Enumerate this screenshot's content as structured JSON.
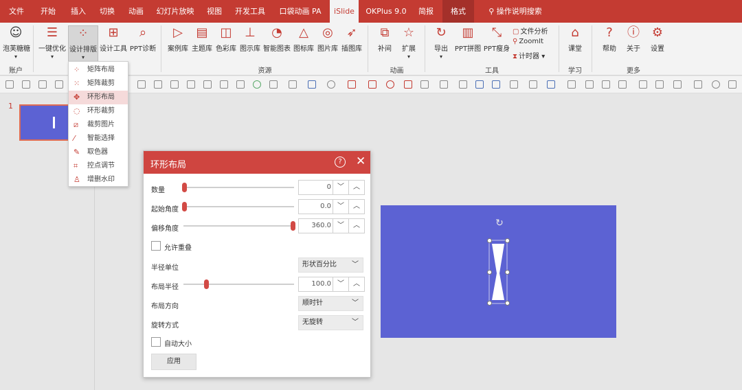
{
  "tabs": [
    {
      "label": "文件"
    },
    {
      "label": "开始"
    },
    {
      "label": "插入"
    },
    {
      "label": "切换"
    },
    {
      "label": "动画"
    },
    {
      "label": "幻灯片放映"
    },
    {
      "label": "视图"
    },
    {
      "label": "开发工具"
    },
    {
      "label": "口袋动画 PA"
    },
    {
      "label": "iSlide"
    },
    {
      "label": "OKPlus 9.0"
    },
    {
      "label": "简报"
    },
    {
      "label": "格式"
    }
  ],
  "tell_me": "操作说明搜索",
  "ribbon": {
    "account": {
      "button": "泡芙糖糖",
      "group": "账户"
    },
    "design": {
      "one_click": "一键优化",
      "layout": "设计排版",
      "tools": "设计工具",
      "diagnose": "PPT诊断"
    },
    "resources": {
      "group": "资源",
      "items": [
        {
          "label": "案例库"
        },
        {
          "label": "主题库"
        },
        {
          "label": "色彩库"
        },
        {
          "label": "图示库"
        },
        {
          "label": "智能图表"
        },
        {
          "label": "图标库"
        },
        {
          "label": "图片库"
        },
        {
          "label": "插图库"
        }
      ]
    },
    "animation": {
      "group": "动画",
      "tween": "补间",
      "extend": "扩展"
    },
    "tools": {
      "group": "工具",
      "export": "导出",
      "ppt_collage": "PPT拼图",
      "ppt_slim": "PPT瘦身",
      "file_analysis": "文件分析",
      "zoomit": "ZoomIt",
      "timer": "计时器"
    },
    "learn": {
      "group": "学习",
      "classroom": "课堂"
    },
    "more": {
      "group": "更多",
      "help": "帮助",
      "about": "关于",
      "settings": "设置"
    }
  },
  "dropdown": {
    "items": [
      {
        "label": "矩阵布局"
      },
      {
        "label": "矩阵裁剪"
      },
      {
        "label": "环形布局"
      },
      {
        "label": "环形裁剪"
      },
      {
        "label": "裁剪图片"
      },
      {
        "label": "智能选择"
      },
      {
        "label": "取色器"
      },
      {
        "label": "控点调节"
      },
      {
        "label": "增删水印"
      }
    ]
  },
  "slide_panel": {
    "slide_number": "1"
  },
  "dialog": {
    "title": "环形布局",
    "help": "?",
    "close": "✕",
    "count": {
      "label": "数量",
      "value": "0",
      "position": 0.0
    },
    "start_angle": {
      "label": "起始角度",
      "value": "0.0",
      "position": 0.0
    },
    "offset_angle": {
      "label": "偏移角度",
      "value": "360.0",
      "position": 1.0
    },
    "allow_overlap": {
      "label": "允许重叠",
      "checked": false
    },
    "radius_unit": {
      "label": "半径单位",
      "value": "形状百分比"
    },
    "layout_radius": {
      "label": "布局半径",
      "value": "100.0",
      "position": 0.2
    },
    "direction": {
      "label": "布局方向",
      "value": "顺时针"
    },
    "rotation": {
      "label": "旋转方式",
      "value": "无旋转"
    },
    "auto_size": {
      "label": "自动大小",
      "checked": false
    },
    "apply": "应用"
  },
  "colors": {
    "accent": "#c43b32",
    "slide_bg": "#5c62d3"
  }
}
